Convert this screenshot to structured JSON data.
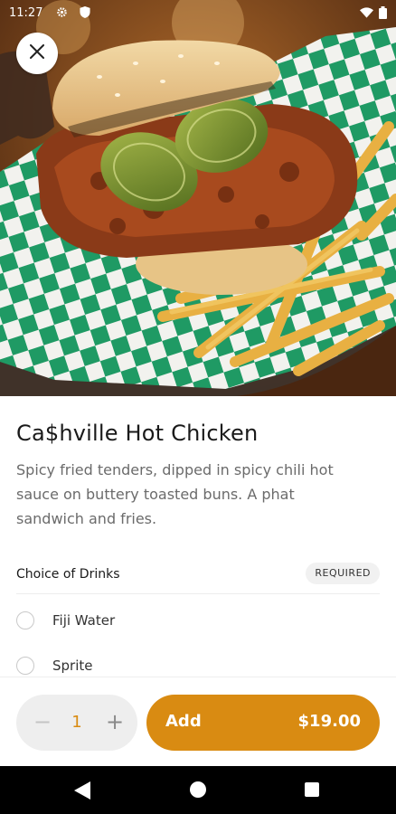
{
  "status_bar": {
    "time": "11:27",
    "icons": [
      "gear-icon",
      "shield-icon",
      "wifi-icon",
      "battery-icon"
    ]
  },
  "hero": {
    "image_subject": "food-photo",
    "close_icon": "close-icon"
  },
  "item": {
    "title": "Ca$hville Hot Chicken",
    "description": "Spicy fried tenders, dipped in spicy chili hot sauce on buttery toasted buns. A phat sandwich and fries."
  },
  "options_section": {
    "title": "Choice of Drinks",
    "badge": "REQUIRED",
    "options": [
      {
        "label": "Fiji Water",
        "selected": false
      },
      {
        "label": "Sprite",
        "selected": false
      }
    ]
  },
  "footer": {
    "quantity": "1",
    "minus_symbol": "−",
    "plus_symbol": "+",
    "add_label": "Add",
    "price": "$19.00"
  },
  "colors": {
    "accent": "#d98b12",
    "stepper_bg": "#eeeeee",
    "badge_bg": "#f1f1f1"
  },
  "nav_bar": {
    "icons": [
      "back-icon",
      "home-icon",
      "recents-icon"
    ]
  }
}
